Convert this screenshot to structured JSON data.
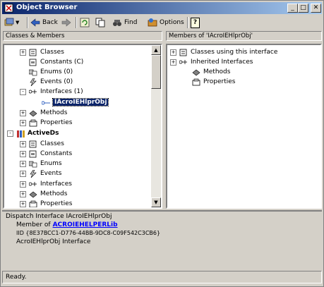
{
  "window": {
    "title": "Object Browser",
    "buttons": [
      "_",
      "□",
      "✕"
    ]
  },
  "toolbar": {
    "back_label": "Back",
    "find_label": "Find",
    "options_label": "Options",
    "help_label": "?"
  },
  "left_pane": {
    "header": "Classes & Members",
    "rows": [
      {
        "label": "Classes",
        "icon": "classes-icon",
        "expander": "+"
      },
      {
        "label": "Constants (C)",
        "icon": "constants-icon",
        "expander": ""
      },
      {
        "label": "Enums (0)",
        "icon": "enums-icon",
        "expander": ""
      },
      {
        "label": "Events (0)",
        "icon": "events-icon",
        "expander": ""
      },
      {
        "label": "Interfaces (1)",
        "icon": "interfaces-icon",
        "expander": "-"
      },
      {
        "label": "IAcroIEHlprObj",
        "icon": "interface-item-icon",
        "expander": "",
        "selected": true
      },
      {
        "label": "Methods",
        "icon": "methods-icon",
        "expander": "+"
      },
      {
        "label": "Properties",
        "icon": "properties-icon",
        "expander": "+"
      },
      {
        "label": "ActiveDs",
        "icon": "library-icon",
        "expander": "-",
        "bold": true
      },
      {
        "label": "Classes",
        "icon": "classes-icon",
        "expander": "+"
      },
      {
        "label": "Constants",
        "icon": "constants-icon",
        "expander": "+"
      },
      {
        "label": "Enums",
        "icon": "enums-icon",
        "expander": "+"
      },
      {
        "label": "Events",
        "icon": "events-icon",
        "expander": "+"
      },
      {
        "label": "Interfaces",
        "icon": "interfaces-icon",
        "expander": "+"
      },
      {
        "label": "Methods",
        "icon": "methods-icon",
        "expander": "+"
      },
      {
        "label": "Properties",
        "icon": "properties-icon",
        "expander": "+"
      }
    ]
  },
  "right_pane": {
    "header": "Members of 'IAcroIEHlprObj'",
    "rows": [
      {
        "label": "Classes using this interface",
        "icon": "classes-icon",
        "expander": "+"
      },
      {
        "label": "Inherited Interfaces",
        "icon": "interfaces-icon",
        "expander": "+"
      },
      {
        "label": "Methods",
        "icon": "methods-icon",
        "expander": ""
      },
      {
        "label": "Properties",
        "icon": "properties-icon",
        "expander": ""
      }
    ]
  },
  "description": {
    "line1": "Dispatch Interface IAcroIEHlprObj",
    "member_of_prefix": "Member of",
    "member_of_link": "ACROIEHELPERLib",
    "iid": "IID {8E37BCC1-D776-44BB-9DC8-C09F542C3CB6}",
    "line4": "AcroIEHlprObj Interface"
  },
  "status": {
    "text": "Ready."
  },
  "colors": {
    "titlebar_start": "#0a246a",
    "titlebar_end": "#a6caf0",
    "selection": "#0a246a",
    "link": "#0000ff"
  }
}
